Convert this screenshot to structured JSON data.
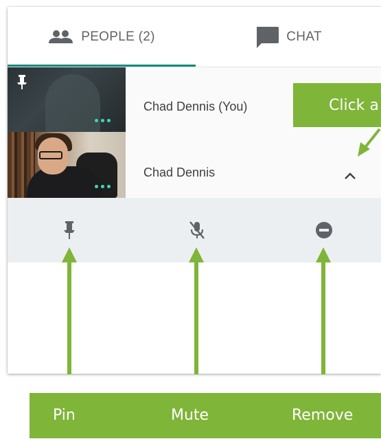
{
  "tabs": {
    "people_label": "PEOPLE (2)",
    "chat_label": "CHAT",
    "active": "people",
    "accent_color": "#0b8a7c",
    "people_icon": "people-icon",
    "chat_icon": "chat-bubble-icon"
  },
  "participants": [
    {
      "name": "Chad Dennis (You)",
      "pinned": true
    },
    {
      "name": "Chad Dennis",
      "pinned": false,
      "expanded": true
    }
  ],
  "actions": {
    "pin_icon": "pin-icon",
    "mute_icon": "mic-off-icon",
    "remove_icon": "remove-circle-icon"
  },
  "annotations": {
    "top_callout": "Click a",
    "labels": {
      "pin": "Pin",
      "mute": "Mute",
      "remove": "Remove"
    },
    "color": "#7fb539"
  },
  "colors": {
    "dots": "#3fd6b2",
    "action_bar": "#eceff1",
    "text": "#3c4043"
  }
}
